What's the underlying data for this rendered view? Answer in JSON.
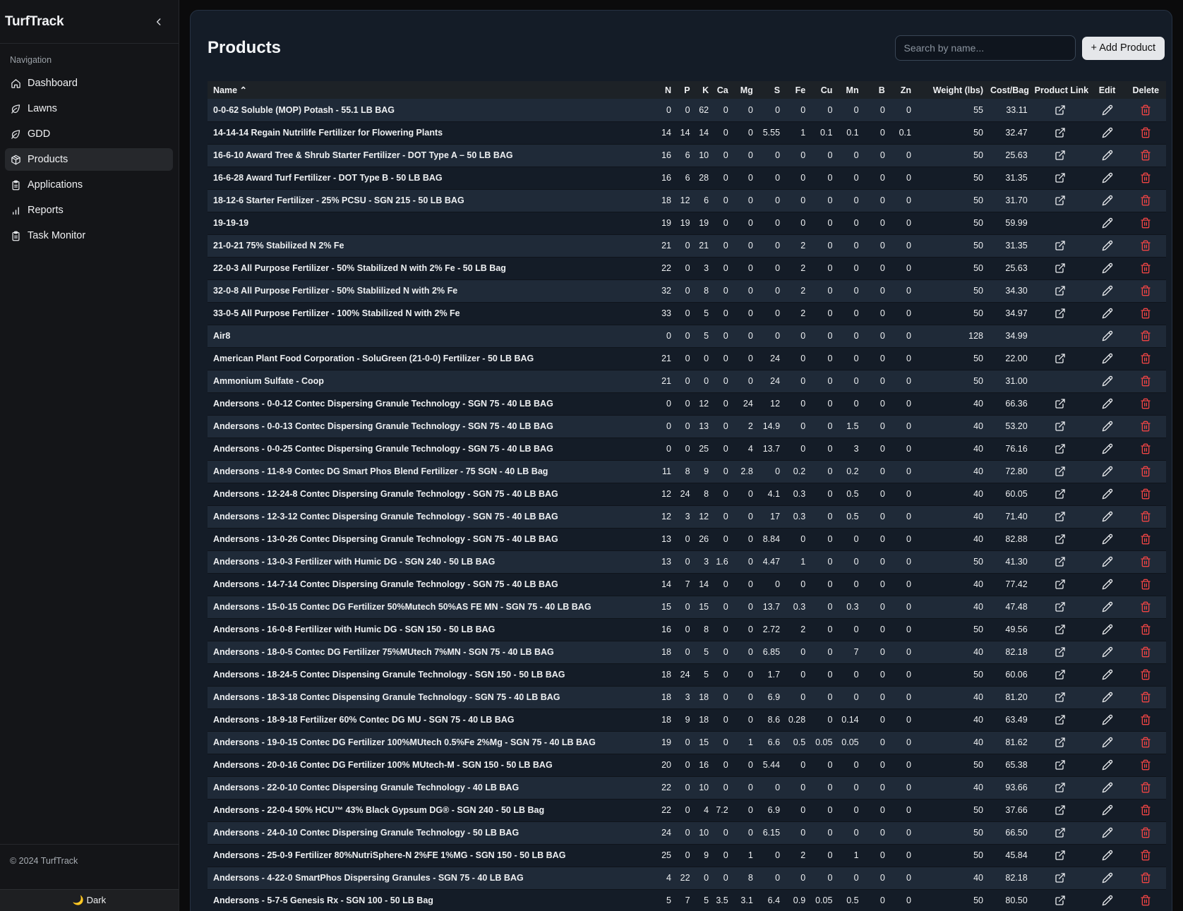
{
  "app": {
    "brand": "TurfTrack"
  },
  "sidebar": {
    "heading": "Navigation",
    "items": [
      {
        "label": "Dashboard",
        "icon": "home-icon",
        "active": false
      },
      {
        "label": "Lawns",
        "icon": "leaf-icon",
        "active": false
      },
      {
        "label": "GDD",
        "icon": "leaf-icon",
        "active": false
      },
      {
        "label": "Products",
        "icon": "package-icon",
        "active": true
      },
      {
        "label": "Applications",
        "icon": "clipboard-icon",
        "active": false
      },
      {
        "label": "Reports",
        "icon": "bar-chart-icon",
        "active": false
      },
      {
        "label": "Task Monitor",
        "icon": "clipboard-icon",
        "active": false
      }
    ],
    "footer": "© 2024 TurfTrack",
    "theme_toggle": "🌙 Dark"
  },
  "page": {
    "title": "Products",
    "search_placeholder": "Search by name...",
    "add_button": "+ Add Product"
  },
  "table": {
    "columns": [
      "Name ⌃",
      "N",
      "P",
      "K",
      "Ca",
      "Mg",
      "S",
      "Fe",
      "Cu",
      "Mn",
      "B",
      "Zn",
      "Weight (lbs)",
      "Cost/Bag",
      "Product Link",
      "Edit",
      "Delete"
    ],
    "sort_indicator": "ascending",
    "rows": [
      {
        "name": "0-0-62 Soluble (MOP) Potash - 55.1 LB BAG",
        "v": [
          "0",
          "0",
          "62",
          "0",
          "0",
          "0",
          "0",
          "0",
          "0",
          "0",
          "0",
          "55",
          "33.11"
        ],
        "link": true
      },
      {
        "name": "14-14-14 Regain Nutrilife Fertilizer for Flowering Plants",
        "v": [
          "14",
          "14",
          "14",
          "0",
          "0",
          "5.55",
          "1",
          "0.1",
          "0.1",
          "0",
          "0.1",
          "50",
          "32.47"
        ],
        "link": true
      },
      {
        "name": "16-6-10 Award Tree & Shrub Starter Fertilizer - DOT Type A – 50 LB BAG",
        "v": [
          "16",
          "6",
          "10",
          "0",
          "0",
          "0",
          "0",
          "0",
          "0",
          "0",
          "0",
          "50",
          "25.63"
        ],
        "link": true
      },
      {
        "name": "16-6-28 Award Turf Fertilizer - DOT Type B - 50 LB BAG",
        "v": [
          "16",
          "6",
          "28",
          "0",
          "0",
          "0",
          "0",
          "0",
          "0",
          "0",
          "0",
          "50",
          "31.35"
        ],
        "link": true
      },
      {
        "name": "18-12-6 Starter Fertilizer - 25% PCSU - SGN 215 - 50 LB BAG",
        "v": [
          "18",
          "12",
          "6",
          "0",
          "0",
          "0",
          "0",
          "0",
          "0",
          "0",
          "0",
          "50",
          "31.70"
        ],
        "link": true
      },
      {
        "name": "19-19-19",
        "v": [
          "19",
          "19",
          "19",
          "0",
          "0",
          "0",
          "0",
          "0",
          "0",
          "0",
          "0",
          "50",
          "59.99"
        ],
        "link": false
      },
      {
        "name": "21-0-21 75% Stabilized N 2% Fe",
        "v": [
          "21",
          "0",
          "21",
          "0",
          "0",
          "0",
          "2",
          "0",
          "0",
          "0",
          "0",
          "50",
          "31.35"
        ],
        "link": true
      },
      {
        "name": "22-0-3 All Purpose Fertilizer - 50% Stabilized N with 2% Fe - 50 LB Bag",
        "v": [
          "22",
          "0",
          "3",
          "0",
          "0",
          "0",
          "2",
          "0",
          "0",
          "0",
          "0",
          "50",
          "25.63"
        ],
        "link": true
      },
      {
        "name": "32-0-8 All Purpose Fertilizer - 50% Stablilized N with 2% Fe",
        "v": [
          "32",
          "0",
          "8",
          "0",
          "0",
          "0",
          "2",
          "0",
          "0",
          "0",
          "0",
          "50",
          "34.30"
        ],
        "link": true
      },
      {
        "name": "33-0-5 All Purpose Fertilizer - 100% Stabilized N with 2% Fe",
        "v": [
          "33",
          "0",
          "5",
          "0",
          "0",
          "0",
          "2",
          "0",
          "0",
          "0",
          "0",
          "50",
          "34.97"
        ],
        "link": true
      },
      {
        "name": "Air8",
        "v": [
          "0",
          "0",
          "5",
          "0",
          "0",
          "0",
          "0",
          "0",
          "0",
          "0",
          "0",
          "128",
          "34.99"
        ],
        "link": false
      },
      {
        "name": "American Plant Food Corporation - SoluGreen (21-0-0) Fertilizer - 50 LB BAG",
        "v": [
          "21",
          "0",
          "0",
          "0",
          "0",
          "24",
          "0",
          "0",
          "0",
          "0",
          "0",
          "50",
          "22.00"
        ],
        "link": true
      },
      {
        "name": "Ammonium Sulfate - Coop",
        "v": [
          "21",
          "0",
          "0",
          "0",
          "0",
          "24",
          "0",
          "0",
          "0",
          "0",
          "0",
          "50",
          "31.00"
        ],
        "link": false
      },
      {
        "name": "Andersons - 0-0-12 Contec Dispersing Granule Technology - SGN 75 - 40 LB BAG",
        "v": [
          "0",
          "0",
          "12",
          "0",
          "24",
          "12",
          "0",
          "0",
          "0",
          "0",
          "0",
          "40",
          "66.36"
        ],
        "link": true
      },
      {
        "name": "Andersons - 0-0-13 Contec Dispersing Granule Technology - SGN 75 - 40 LB BAG",
        "v": [
          "0",
          "0",
          "13",
          "0",
          "2",
          "14.9",
          "0",
          "0",
          "1.5",
          "0",
          "0",
          "40",
          "53.20"
        ],
        "link": true
      },
      {
        "name": "Andersons - 0-0-25 Contec Dispersing Granule Technology - SGN 75 - 40 LB BAG",
        "v": [
          "0",
          "0",
          "25",
          "0",
          "4",
          "13.7",
          "0",
          "0",
          "3",
          "0",
          "0",
          "40",
          "76.16"
        ],
        "link": true
      },
      {
        "name": "Andersons - 11-8-9 Contec DG Smart Phos Blend Fertilizer - 75 SGN - 40 LB Bag",
        "v": [
          "11",
          "8",
          "9",
          "0",
          "2.8",
          "0",
          "0.2",
          "0",
          "0.2",
          "0",
          "0",
          "40",
          "72.80"
        ],
        "link": true
      },
      {
        "name": "Andersons - 12-24-8 Contec Dispersing Granule Technology - SGN 75 - 40 LB BAG",
        "v": [
          "12",
          "24",
          "8",
          "0",
          "0",
          "4.1",
          "0.3",
          "0",
          "0.5",
          "0",
          "0",
          "40",
          "60.05"
        ],
        "link": true
      },
      {
        "name": "Andersons - 12-3-12 Contec Dispersing Granule Technology - SGN 75 - 40 LB BAG",
        "v": [
          "12",
          "3",
          "12",
          "0",
          "0",
          "17",
          "0.3",
          "0",
          "0.5",
          "0",
          "0",
          "40",
          "71.40"
        ],
        "link": true
      },
      {
        "name": "Andersons - 13-0-26 Contec Dispersing Granule Technology - SGN 75 - 40 LB BAG",
        "v": [
          "13",
          "0",
          "26",
          "0",
          "0",
          "8.84",
          "0",
          "0",
          "0",
          "0",
          "0",
          "40",
          "82.88"
        ],
        "link": true
      },
      {
        "name": "Andersons - 13-0-3 Fertilizer with Humic DG - SGN 240 - 50 LB BAG",
        "v": [
          "13",
          "0",
          "3",
          "1.6",
          "0",
          "4.47",
          "1",
          "0",
          "0",
          "0",
          "0",
          "50",
          "41.30"
        ],
        "link": true
      },
      {
        "name": "Andersons - 14-7-14 Contec Dispersing Granule Technology - SGN 75 - 40 LB BAG",
        "v": [
          "14",
          "7",
          "14",
          "0",
          "0",
          "0",
          "0",
          "0",
          "0",
          "0",
          "0",
          "40",
          "77.42"
        ],
        "link": true
      },
      {
        "name": "Andersons - 15-0-15 Contec DG Fertilizer 50%Mutech 50%AS FE MN - SGN 75 - 40 LB BAG",
        "v": [
          "15",
          "0",
          "15",
          "0",
          "0",
          "13.7",
          "0.3",
          "0",
          "0.3",
          "0",
          "0",
          "40",
          "47.48"
        ],
        "link": true
      },
      {
        "name": "Andersons - 16-0-8 Fertilizer with Humic DG - SGN 150 - 50 LB BAG",
        "v": [
          "16",
          "0",
          "8",
          "0",
          "0",
          "2.72",
          "2",
          "0",
          "0",
          "0",
          "0",
          "50",
          "49.56"
        ],
        "link": true
      },
      {
        "name": "Andersons - 18-0-5 Contec DG Fertilizer 75%MUtech 7%MN - SGN 75 - 40 LB BAG",
        "v": [
          "18",
          "0",
          "5",
          "0",
          "0",
          "6.85",
          "0",
          "0",
          "7",
          "0",
          "0",
          "40",
          "82.18"
        ],
        "link": true
      },
      {
        "name": "Andersons - 18-24-5 Contec Dispensing Granule Technology - SGN 150 - 50 LB BAG",
        "v": [
          "18",
          "24",
          "5",
          "0",
          "0",
          "1.7",
          "0",
          "0",
          "0",
          "0",
          "0",
          "50",
          "60.06"
        ],
        "link": true
      },
      {
        "name": "Andersons - 18-3-18 Contec Dispensing Granule Technology - SGN 75 - 40 LB BAG",
        "v": [
          "18",
          "3",
          "18",
          "0",
          "0",
          "6.9",
          "0",
          "0",
          "0",
          "0",
          "0",
          "40",
          "81.20"
        ],
        "link": true
      },
      {
        "name": "Andersons - 18-9-18 Fertilizer 60% Contec DG MU - SGN 75 - 40 LB BAG",
        "v": [
          "18",
          "9",
          "18",
          "0",
          "0",
          "8.6",
          "0.28",
          "0",
          "0.14",
          "0",
          "0",
          "40",
          "63.49"
        ],
        "link": true
      },
      {
        "name": "Andersons - 19-0-15 Contec DG Fertilizer 100%MUtech 0.5%Fe 2%Mg - SGN 75 - 40 LB BAG",
        "v": [
          "19",
          "0",
          "15",
          "0",
          "1",
          "6.6",
          "0.5",
          "0.05",
          "0.05",
          "0",
          "0",
          "40",
          "81.62"
        ],
        "link": true
      },
      {
        "name": "Andersons - 20-0-16 Contec DG Fertilizer 100% MUtech-M - SGN 150 - 50 LB BAG",
        "v": [
          "20",
          "0",
          "16",
          "0",
          "0",
          "5.44",
          "0",
          "0",
          "0",
          "0",
          "0",
          "50",
          "65.38"
        ],
        "link": true
      },
      {
        "name": "Andersons - 22-0-10 Contec Dispersing Granule Technology - 40 LB BAG",
        "v": [
          "22",
          "0",
          "10",
          "0",
          "0",
          "0",
          "0",
          "0",
          "0",
          "0",
          "0",
          "40",
          "93.66"
        ],
        "link": true
      },
      {
        "name": "Andersons - 22-0-4 50% HCU™ 43% Black Gypsum DG® - SGN 240 - 50 LB Bag",
        "v": [
          "22",
          "0",
          "4",
          "7.2",
          "0",
          "6.9",
          "0",
          "0",
          "0",
          "0",
          "0",
          "50",
          "37.66"
        ],
        "link": true
      },
      {
        "name": "Andersons - 24-0-10 Contec Dispersing Granule Technology - 50 LB BAG",
        "v": [
          "24",
          "0",
          "10",
          "0",
          "0",
          "6.15",
          "0",
          "0",
          "0",
          "0",
          "0",
          "50",
          "66.50"
        ],
        "link": true
      },
      {
        "name": "Andersons - 25-0-9 Fertilizer 80%NutriSphere-N 2%FE 1%MG - SGN 150 - 50 LB BAG",
        "v": [
          "25",
          "0",
          "9",
          "0",
          "1",
          "0",
          "2",
          "0",
          "1",
          "0",
          "0",
          "50",
          "45.84"
        ],
        "link": true
      },
      {
        "name": "Andersons - 4-22-0 SmartPhos Dispersing Granules - SGN 75 - 40 LB BAG",
        "v": [
          "4",
          "22",
          "0",
          "0",
          "8",
          "0",
          "0",
          "0",
          "0",
          "0",
          "0",
          "40",
          "82.18"
        ],
        "link": true
      },
      {
        "name": "Andersons - 5-7-5 Genesis Rx - SGN 100 - 50 LB Bag",
        "v": [
          "5",
          "7",
          "5",
          "3.5",
          "3.1",
          "6.4",
          "0.9",
          "0.05",
          "0.5",
          "0",
          "0",
          "50",
          "80.50"
        ],
        "link": true
      }
    ]
  },
  "colors": {
    "delete": "#ef4444",
    "accent": "#e5e7ea",
    "row_alt": "#1f2a38"
  }
}
